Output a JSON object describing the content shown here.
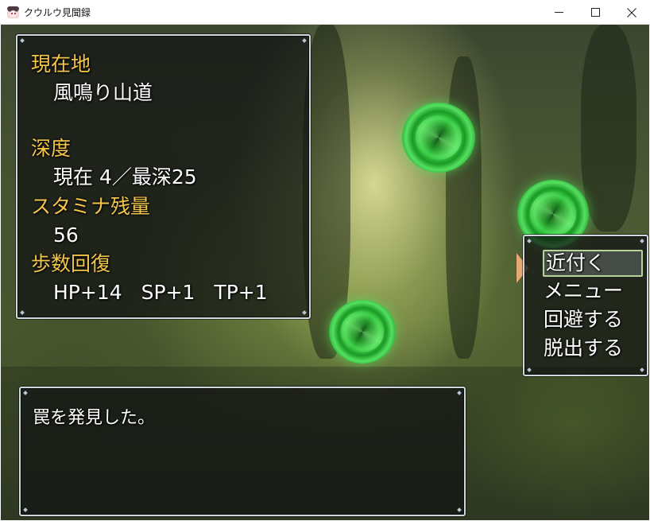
{
  "window": {
    "title": "クウルウ見聞録",
    "icon": "game-character-icon",
    "buttons": {
      "minimize_icon": "minimize-icon",
      "maximize_icon": "maximize-icon",
      "close_icon": "close-icon"
    }
  },
  "status": {
    "location_label": "現在地",
    "location_value": "風鳴り山道",
    "depth_label": "深度",
    "depth_value": "現在 4／最深25",
    "stamina_label": "スタミナ残量",
    "stamina_value": "56",
    "recovery_label": "歩数回復",
    "recovery": {
      "hp": "HP+14",
      "sp": "SP+1",
      "tp": "TP+1"
    }
  },
  "commands": {
    "items": [
      {
        "label": "近付く",
        "selected": true
      },
      {
        "label": "メニュー",
        "selected": false
      },
      {
        "label": "回避する",
        "selected": false
      },
      {
        "label": "脱出する",
        "selected": false
      }
    ]
  },
  "message": {
    "text": "罠を発見した。"
  },
  "scene": {
    "background": "forest-ravine-background",
    "portals": [
      "green-vortex-portal",
      "green-vortex-portal",
      "green-vortex-portal"
    ]
  },
  "colors": {
    "header_text": "#f3c54a",
    "body_text": "#ffffff",
    "window_bg": "rgba(16,18,20,0.72)",
    "selection_border": "#b7d59b",
    "cursor": "#e7a974"
  }
}
